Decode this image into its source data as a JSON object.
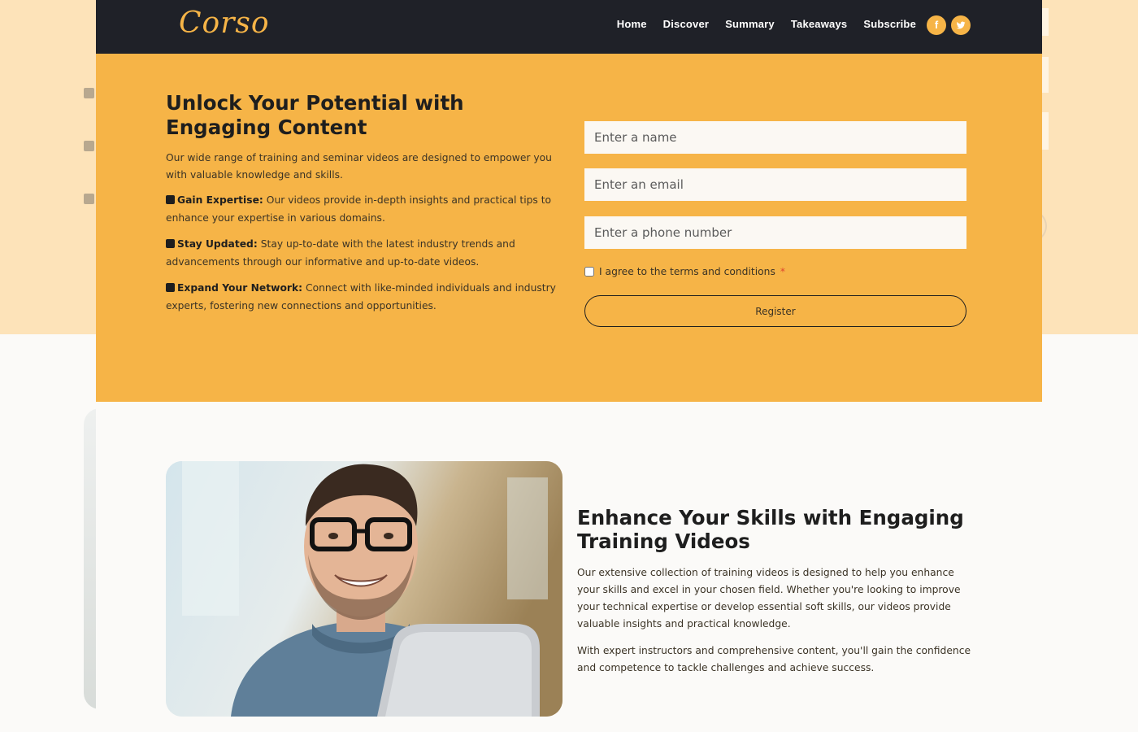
{
  "header": {
    "logo": "Corso",
    "nav": [
      "Home",
      "Discover",
      "Summary",
      "Takeaways",
      "Subscribe"
    ],
    "social": [
      {
        "icon": "facebook-icon",
        "glyph": "f"
      },
      {
        "icon": "twitter-icon",
        "glyph": "t"
      }
    ]
  },
  "hero": {
    "title": "Unlock Your Potential with Engaging Content",
    "intro": "Our wide range of training and seminar videos are designed to empower you with valuable knowledge and skills.",
    "features": [
      {
        "label": "Gain Expertise:",
        "text": " Our videos provide in-depth insights and practical tips to enhance your expertise in various domains."
      },
      {
        "label": "Stay Updated:",
        "text": " Stay up-to-date with the latest industry trends and advancements through our informative and up-to-date videos."
      },
      {
        "label": "Expand Your Network:",
        "text": " Connect with like-minded individuals and industry experts, fostering new connections and opportunities."
      }
    ]
  },
  "form": {
    "name_placeholder": "Enter a name",
    "email_placeholder": "Enter an email",
    "phone_placeholder": "Enter a phone number",
    "terms_label": "I agree to the terms and conditions",
    "required_mark": "*",
    "register_label": "Register"
  },
  "section2": {
    "title": "Enhance Your Skills with Engaging Training Videos",
    "p1": "Our extensive collection of training videos is designed to help you enhance your skills and excel in your chosen field. Whether you're looking to improve your technical expertise or develop essential soft skills, our videos provide valuable insights and practical knowledge.",
    "p2": "With expert instructors and comprehensive content, you'll gain the confidence and competence to tackle challenges and achieve success."
  },
  "colors": {
    "accent": "#f6b447",
    "header_bg": "#1f2128",
    "page_bg": "#fbfaf8"
  }
}
